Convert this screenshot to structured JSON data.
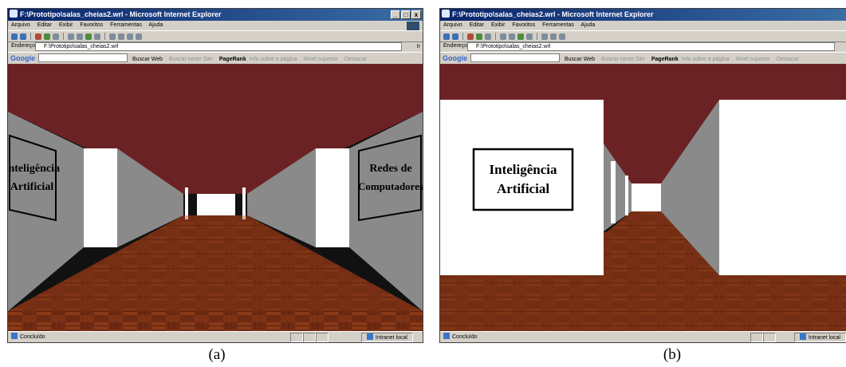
{
  "window": {
    "title": "F:\\Prototipo\\salas_cheias2.wrl - Microsoft Internet Explorer",
    "min": "_",
    "max": "□",
    "close": "x"
  },
  "menu": [
    "Arquivo",
    "Editar",
    "Exibir",
    "Favoritos",
    "Ferramentas",
    "Ajuda"
  ],
  "address": {
    "label": "Endereço",
    "value": "F:\\Prototipo\\salas_cheias2.wrl",
    "go_label": "Ir"
  },
  "google": {
    "logo": "Google",
    "search_web": "Buscar Web",
    "search_site": "Buscar neste Site",
    "pagerank": "PageRank",
    "page_info": "Info sobre a página",
    "up_level": "Nível superior",
    "highlight": "Destacar"
  },
  "status": {
    "text": "Concluído",
    "zone": "Intranet local"
  },
  "panel_a": {
    "caption": "(a)",
    "sign_left": [
      "Inteligência",
      "Artificial"
    ],
    "sign_right": [
      "Redes de",
      "Computadores"
    ]
  },
  "panel_b": {
    "caption": "(b)",
    "sign_left": [
      "Inteligência",
      "Artificial"
    ]
  },
  "colors": {
    "ceiling": "#6b2224",
    "wall_side": "#8a8a8a",
    "wall_front": "#ffffff",
    "floor": "#6e2a12",
    "titlebar": "#0a246a"
  }
}
